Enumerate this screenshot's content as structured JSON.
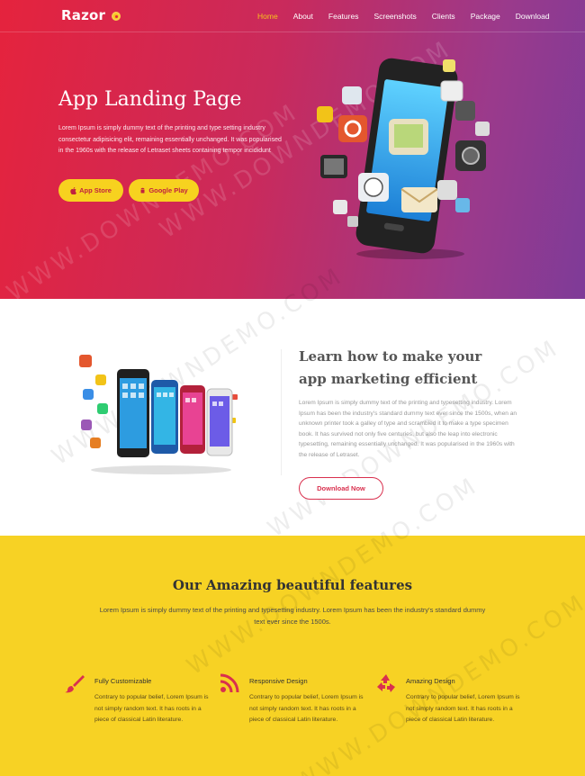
{
  "logo": {
    "text": "Razor"
  },
  "nav": [
    "Home",
    "About",
    "Features",
    "Screenshots",
    "Clients",
    "Package",
    "Download"
  ],
  "hero": {
    "title": "App Landing Page",
    "text": "Lorem Ipsum is simply dummy text of the printing and type setting industry consectetur adipisicing elit, remaining essentially unchanged. It was popularised in the 1960s with the release of Letraset sheets containing tempor incididunt",
    "btn_appstore": "App Store",
    "btn_google": "Google Play"
  },
  "marketing": {
    "title": "Learn how to make your app marketing efficient",
    "text": "Lorem Ipsum is simply dummy text of the printing and typesetting industry. Lorem Ipsum has been the industry's standard dummy text ever since the 1500s, when an unknown printer took a galley of type and scrambled it to make a type specimen book. It has survived not only five centuries, but also the leap into electronic typesetting, remaining essentially unchanged. It was popularised in the 1960s with the release of Letraset.",
    "btn": "Download Now"
  },
  "features": {
    "title": "Our Amazing beautiful features",
    "subtitle": "Lorem Ipsum is simply dummy text of the printing and typesetting industry. Lorem Ipsum has been the industry's standard dummy text ever since the 1500s.",
    "items": [
      {
        "title": "Fully Customizable",
        "text": "Contrary to popular belief, Lorem Ipsum is not simply random text. It has roots in a piece of classical Latin literature.",
        "icon": "brush-icon"
      },
      {
        "title": "Responsive Design",
        "text": "Contrary to popular belief, Lorem Ipsum is not simply random text. It has roots in a piece of classical Latin literature.",
        "icon": "rss-icon"
      },
      {
        "title": "Amazing Design",
        "text": "Contrary to popular belief, Lorem Ipsum is not simply random text. It has roots in a piece of classical Latin literature.",
        "icon": "recycle-icon"
      }
    ]
  },
  "colors": {
    "accent_red": "#d9304e",
    "accent_yellow": "#f7d224",
    "nav_active": "#f7c31c"
  }
}
